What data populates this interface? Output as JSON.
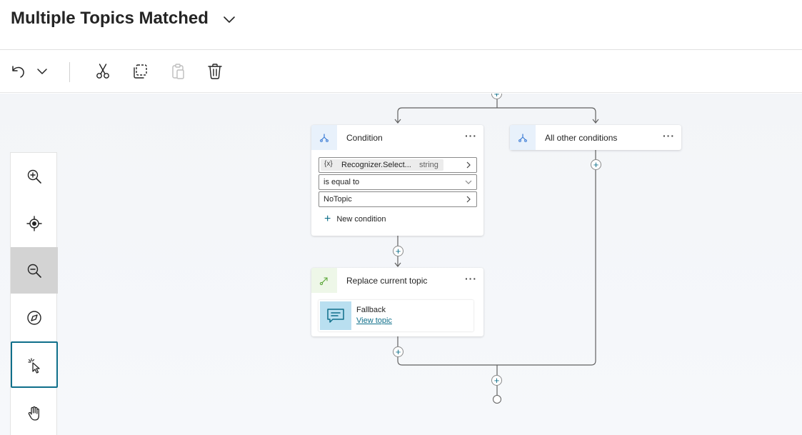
{
  "header": {
    "title": "Multiple Topics Matched"
  },
  "toolbar": {
    "undo_icon": "undo-icon",
    "undo_menu_icon": "chevron-down-icon",
    "cut_icon": "scissors-icon",
    "copy_icon": "copy-icon",
    "paste_icon": "paste-icon",
    "delete_icon": "trash-icon"
  },
  "zoom_panel": {
    "items": [
      {
        "icon": "zoom-in-icon"
      },
      {
        "icon": "recenter-icon"
      },
      {
        "icon": "zoom-out-icon",
        "active": true
      },
      {
        "icon": "compass-icon"
      },
      {
        "icon": "select-pointer-icon",
        "selected": true
      },
      {
        "icon": "pan-hand-icon"
      }
    ]
  },
  "condition_node": {
    "title": "Condition",
    "more": "···",
    "variable": {
      "icon_text": "{x}",
      "name": "Recognizer.Select...",
      "type": "string"
    },
    "operator": "is equal to",
    "value": "NoTopic",
    "new_condition_label": "New condition"
  },
  "other_node": {
    "title": "All other conditions",
    "more": "···"
  },
  "replace_node": {
    "title": "Replace current topic",
    "more": "···",
    "topic_name": "Fallback",
    "topic_link": "View topic"
  },
  "colors": {
    "accent": "#0f6f8a",
    "condition_icon_bg": "#e8f1fb",
    "replace_icon_bg": "#eef7e8",
    "topic_icon_bg": "#b9dff0"
  }
}
